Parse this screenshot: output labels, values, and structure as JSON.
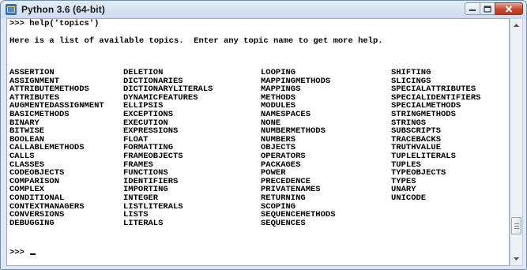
{
  "window": {
    "title": "Python 3.6 (64-bit)",
    "icon": "python-icon",
    "controls": [
      "minimize-icon",
      "maximize-icon",
      "close-icon"
    ]
  },
  "console": {
    "prompt_line": ">>> help('topics')",
    "intro": "Here is a list of available topics.  Enter any topic name to get more help.",
    "columns": [
      [
        "ASSERTION",
        "ASSIGNMENT",
        "ATTRIBUTEMETHODS",
        "ATTRIBUTES",
        "AUGMENTEDASSIGNMENT",
        "BASICMETHODS",
        "BINARY",
        "BITWISE",
        "BOOLEAN",
        "CALLABLEMETHODS",
        "CALLS",
        "CLASSES",
        "CODEOBJECTS",
        "COMPARISON",
        "COMPLEX",
        "CONDITIONAL",
        "CONTEXTMANAGERS",
        "CONVERSIONS",
        "DEBUGGING"
      ],
      [
        "DELETION",
        "DICTIONARIES",
        "DICTIONARYLITERALS",
        "DYNAMICFEATURES",
        "ELLIPSIS",
        "EXCEPTIONS",
        "EXECUTION",
        "EXPRESSIONS",
        "FLOAT",
        "FORMATTING",
        "FRAMEOBJECTS",
        "FRAMES",
        "FUNCTIONS",
        "IDENTIFIERS",
        "IMPORTING",
        "INTEGER",
        "LISTLITERALS",
        "LISTS",
        "LITERALS"
      ],
      [
        "LOOPING",
        "MAPPINGMETHODS",
        "MAPPINGS",
        "METHODS",
        "MODULES",
        "NAMESPACES",
        "NONE",
        "NUMBERMETHODS",
        "NUMBERS",
        "OBJECTS",
        "OPERATORS",
        "PACKAGES",
        "POWER",
        "PRECEDENCE",
        "PRIVATENAMES",
        "RETURNING",
        "SCOPING",
        "SEQUENCEMETHODS",
        "SEQUENCES"
      ],
      [
        "SHIFTING",
        "SLICINGS",
        "SPECIALATTRIBUTES",
        "SPECIALIDENTIFIERS",
        "SPECIALMETHODS",
        "STRINGMETHODS",
        "STRINGS",
        "SUBSCRIPTS",
        "TRACEBACKS",
        "TRUTHVALUE",
        "TUPLELITERALS",
        "TUPLES",
        "TYPEOBJECTS",
        "TYPES",
        "UNARY",
        "UNICODE"
      ]
    ],
    "final_prompt": ">>> "
  },
  "colors": {
    "frame": "#dfe9f5",
    "close_button": "#c7472f",
    "console_bg": "#ffffff",
    "text": "#000000"
  }
}
